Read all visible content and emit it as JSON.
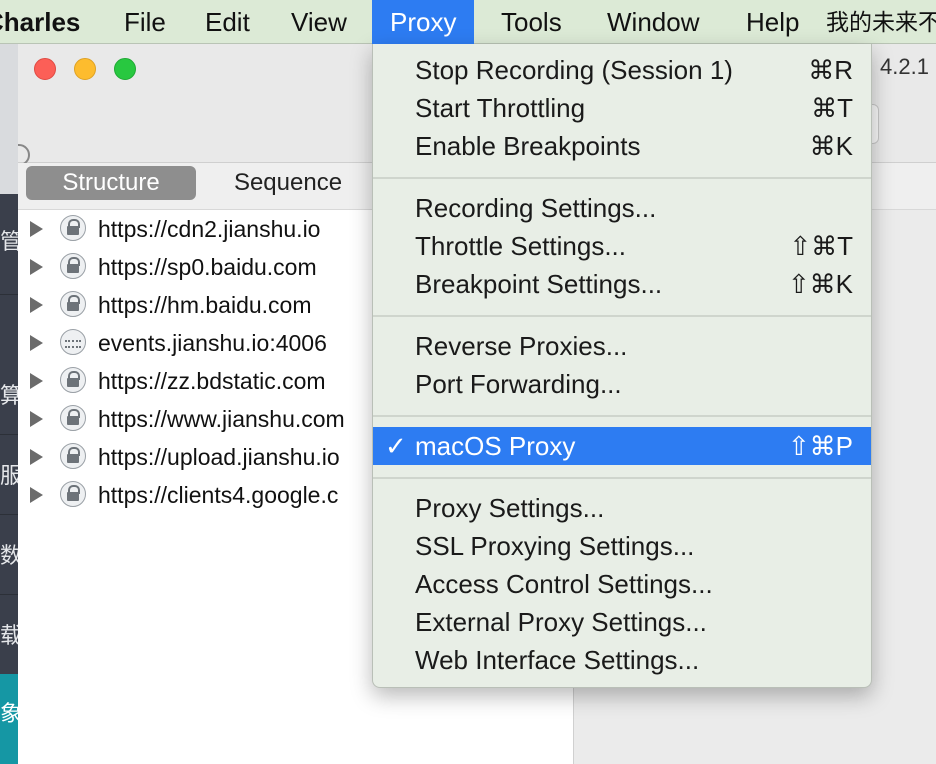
{
  "menubar": {
    "app_name": "Charles",
    "items": [
      "File",
      "Edit",
      "View",
      "Proxy",
      "Tools",
      "Window",
      "Help"
    ],
    "extra_text": "我的未来不",
    "active_item": "Proxy"
  },
  "side_strip": {
    "chars": [
      "管",
      "算",
      "服",
      "数",
      "载",
      "象"
    ]
  },
  "window": {
    "version_label": "4.2.1",
    "tabs": [
      {
        "label": "Structure",
        "selected": true
      },
      {
        "label": "Sequence",
        "selected": false
      }
    ],
    "hosts": [
      {
        "label": "https://cdn2.jianshu.io",
        "icon": "lock-icon"
      },
      {
        "label": "https://sp0.baidu.com",
        "icon": "lock-icon"
      },
      {
        "label": "https://hm.baidu.com",
        "icon": "lock-icon"
      },
      {
        "label": "events.jianshu.io:4006",
        "icon": "connection-icon"
      },
      {
        "label": "https://zz.bdstatic.com",
        "icon": "lock-icon"
      },
      {
        "label": "https://www.jianshu.com",
        "icon": "lock-icon"
      },
      {
        "label": "https://upload.jianshu.io",
        "icon": "lock-icon"
      },
      {
        "label": "https://clients4.google.c",
        "icon": "lock-icon"
      }
    ]
  },
  "proxy_menu": {
    "groups": [
      [
        {
          "label": "Stop Recording (Session 1)",
          "shortcut": "⌘R"
        },
        {
          "label": "Start Throttling",
          "shortcut": "⌘T"
        },
        {
          "label": "Enable Breakpoints",
          "shortcut": "⌘K"
        }
      ],
      [
        {
          "label": "Recording Settings...",
          "shortcut": ""
        },
        {
          "label": "Throttle Settings...",
          "shortcut": "⇧⌘T"
        },
        {
          "label": "Breakpoint Settings...",
          "shortcut": "⇧⌘K"
        }
      ],
      [
        {
          "label": "Reverse Proxies...",
          "shortcut": ""
        },
        {
          "label": "Port Forwarding...",
          "shortcut": ""
        }
      ],
      [
        {
          "label": "macOS Proxy",
          "shortcut": "⇧⌘P",
          "checked": true,
          "check_mark": "✓",
          "highlighted": true
        }
      ],
      [
        {
          "label": "Proxy Settings...",
          "shortcut": ""
        },
        {
          "label": "SSL Proxying Settings...",
          "shortcut": ""
        },
        {
          "label": "Access Control Settings...",
          "shortcut": ""
        },
        {
          "label": "External Proxy Settings...",
          "shortcut": ""
        },
        {
          "label": "Web Interface Settings...",
          "shortcut": ""
        }
      ]
    ]
  },
  "colors": {
    "menubar_bg": "#dcead6",
    "highlight": "#2d7cf2",
    "menu_bg": "#e8eee6"
  }
}
